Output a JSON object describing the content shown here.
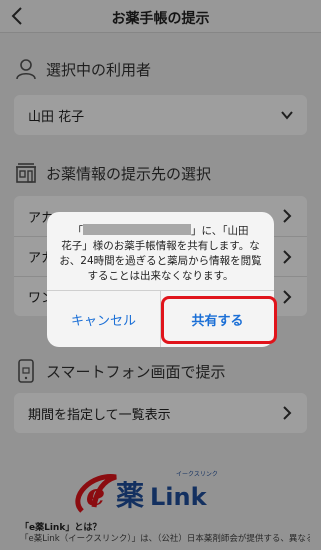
{
  "nav": {
    "title": "お薬手帳の提示"
  },
  "users_section": {
    "title": "選択中の利用者",
    "selected_user": "山田 花子"
  },
  "dest_section": {
    "title": "お薬情報の提示先の選択",
    "items": [
      {
        "label": "アカ"
      },
      {
        "label": "アカ"
      },
      {
        "label": "ワン"
      }
    ]
  },
  "smartphone_section": {
    "title": "スマートフォン画面で提示",
    "item": "期間を指定して一覧表示"
  },
  "about": {
    "title": "「e薬Link」とは？",
    "text": "「e薬Link（イークスリンク）」は、（公社）日本薬剤師会が提供する、異なる電子お薬手帳サービス間の情報を相互閲覧できるようにする仕組みです。"
  },
  "logo": {
    "main": "e薬Link",
    "ruby": "イークスリンク"
  },
  "alert": {
    "line1_prefix": "「",
    "line1_suffix": "」に、「山田",
    "line2": "花子」様のお薬手帳情報を共有します。な",
    "line3": "お、24時間を過ぎると薬局から情報を閲覧",
    "line4": "することは出来なくなります。",
    "cancel_label": "キャンセル",
    "share_label": "共有する"
  },
  "colors": {
    "accent": "#1b6fd6",
    "highlight": "#e0141b",
    "logo_red": "#e0141b",
    "logo_blue": "#1f4e9c"
  }
}
